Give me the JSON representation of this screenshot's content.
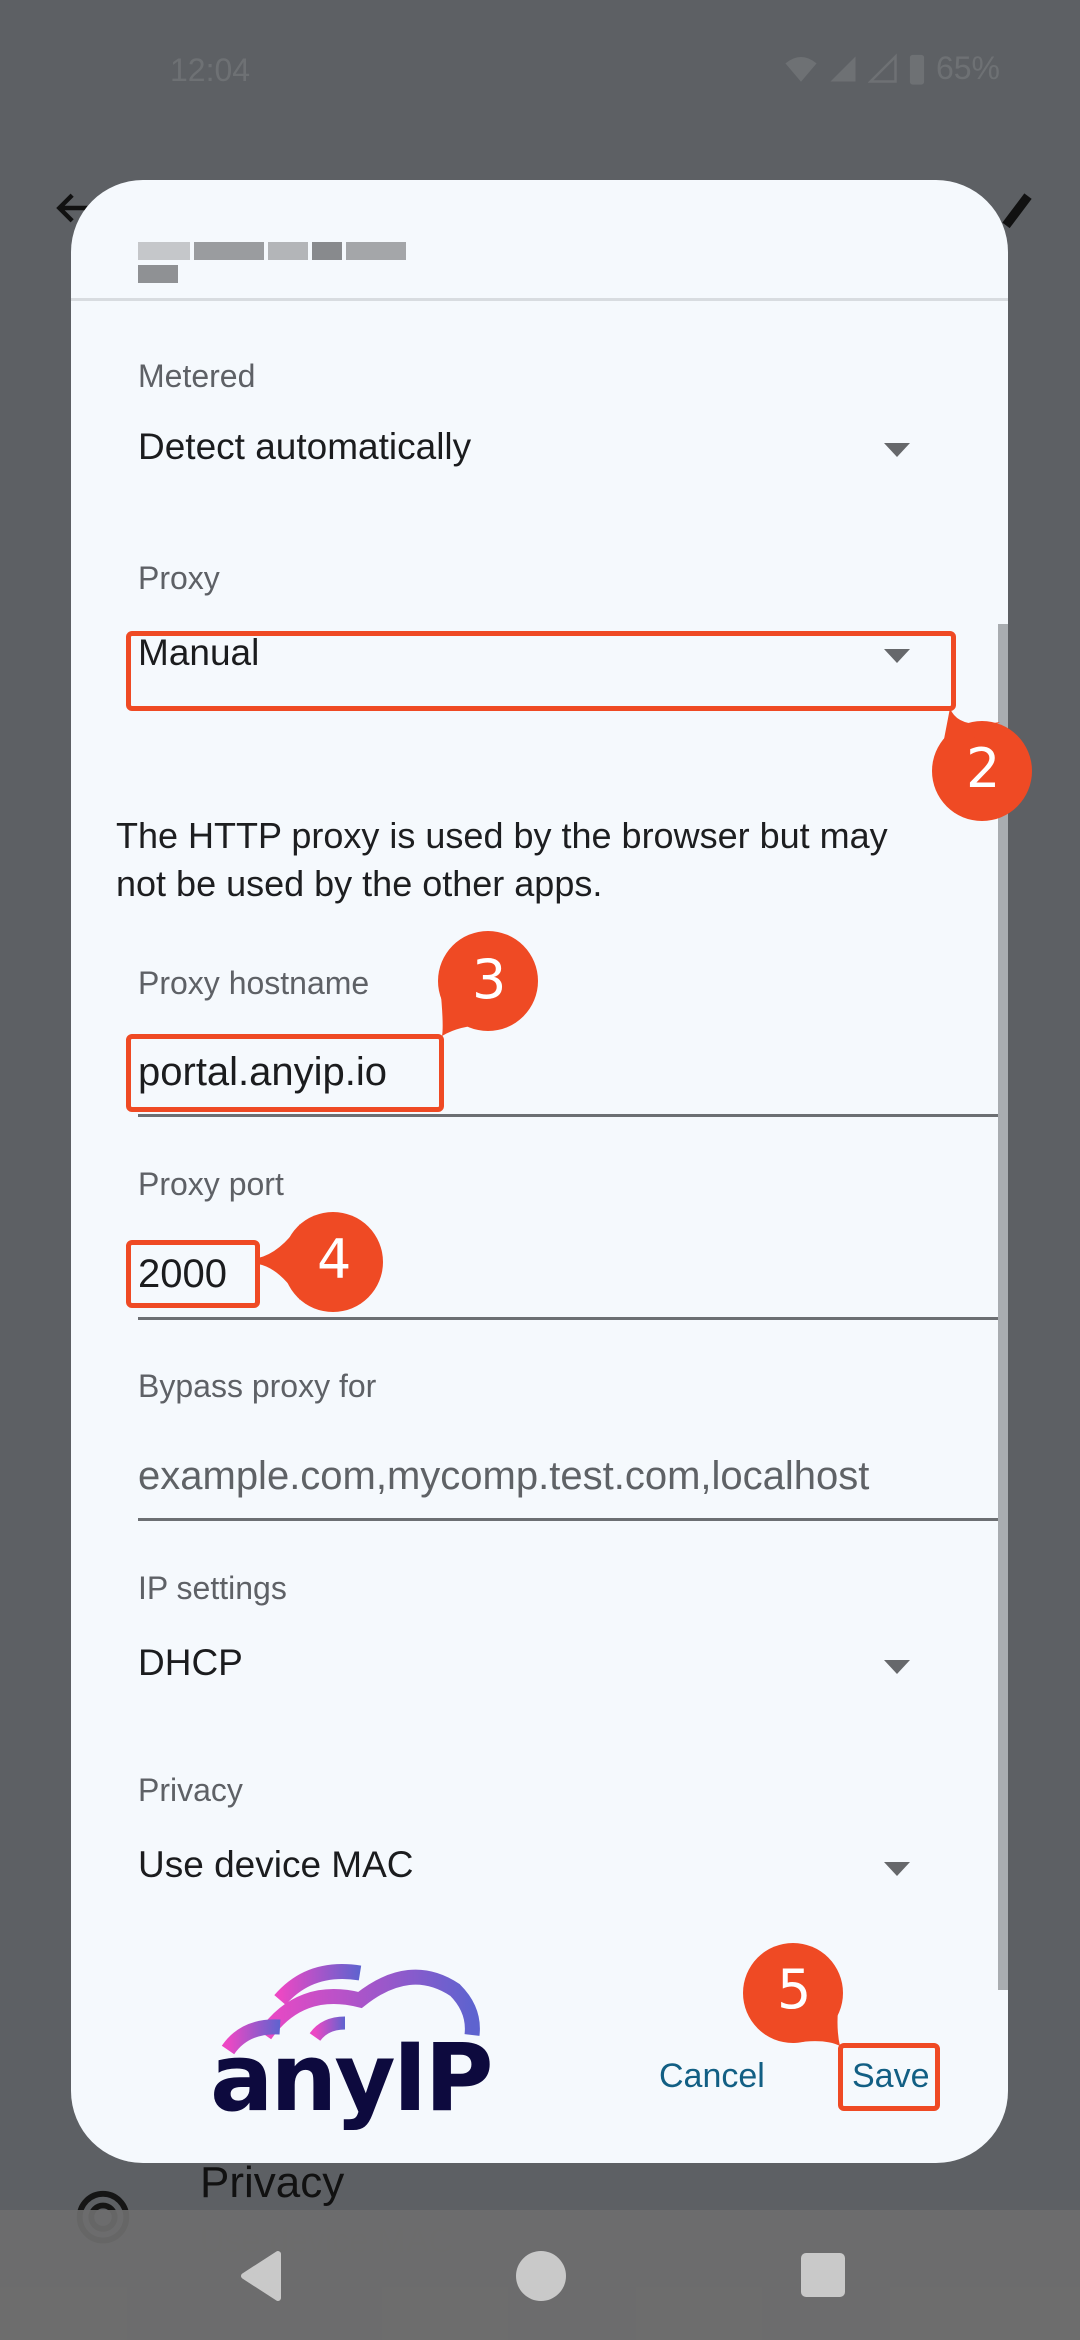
{
  "status_bar": {
    "time": "12:04",
    "battery": "65%",
    "icons": [
      "wifi-icon",
      "signal-icon",
      "signal-icon",
      "battery-icon"
    ]
  },
  "background": {
    "back_icon": "arrow-left-icon",
    "edit_icon": "pencil-icon",
    "privacy_label": "Privacy",
    "privacy_value": "Use device MAC"
  },
  "dialog": {
    "title": "[redacted network name]",
    "fields": {
      "metered": {
        "label": "Metered",
        "value": "Detect automatically"
      },
      "proxy": {
        "label": "Proxy",
        "value": "Manual"
      },
      "proxy_info": "The HTTP proxy is used by the browser but may not be used by the other apps.",
      "proxy_info_line1": "The HTTP proxy is used by the browser but may",
      "proxy_info_line2": "not be used by the other apps.",
      "hostname": {
        "label": "Proxy hostname",
        "value": "portal.anyip.io"
      },
      "port": {
        "label": "Proxy port",
        "value": "2000"
      },
      "bypass": {
        "label": "Bypass proxy for",
        "placeholder": "example.com,mycomp.test.com,localhost"
      },
      "ip_settings": {
        "label": "IP settings",
        "value": "DHCP"
      },
      "privacy": {
        "label": "Privacy",
        "value": "Use device MAC"
      }
    },
    "buttons": {
      "cancel": "Cancel",
      "save": "Save"
    },
    "logo_text": "anyIP"
  },
  "annotations": {
    "color": "#ef4a24",
    "steps": [
      {
        "number": "2",
        "target": "proxy-dropdown"
      },
      {
        "number": "3",
        "target": "proxy-hostname-input"
      },
      {
        "number": "4",
        "target": "proxy-port-input"
      },
      {
        "number": "5",
        "target": "save-button"
      }
    ]
  },
  "colors": {
    "dialog_bg": "#f5f9fd",
    "button_text": "#125f84",
    "logo_text": "#0d0a3e",
    "logo_gradient_start": "#ec48c4",
    "logo_gradient_end": "#5e63cf"
  },
  "nav_bar": {
    "buttons": [
      "back-nav-icon",
      "home-nav-icon",
      "recents-nav-icon"
    ]
  }
}
